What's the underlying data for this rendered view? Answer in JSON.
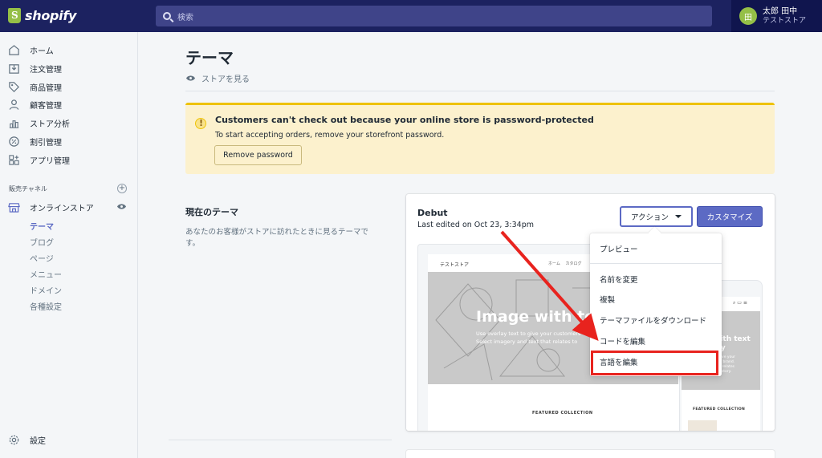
{
  "app": {
    "name": "shopify"
  },
  "search": {
    "placeholder": "検索"
  },
  "user": {
    "initial": "田",
    "name": "太郎 田中",
    "store": "テストストア"
  },
  "sidebar": {
    "items": [
      {
        "label": "ホーム",
        "icon": "home-icon"
      },
      {
        "label": "注文管理",
        "icon": "orders-icon"
      },
      {
        "label": "商品管理",
        "icon": "tag-icon"
      },
      {
        "label": "顧客管理",
        "icon": "person-icon"
      },
      {
        "label": "ストア分析",
        "icon": "analytics-icon"
      },
      {
        "label": "割引管理",
        "icon": "discount-icon"
      },
      {
        "label": "アプリ管理",
        "icon": "apps-icon"
      }
    ],
    "channels_label": "販売チャネル",
    "online_store": "オンラインストア",
    "sub_items": [
      "テーマ",
      "ブログ",
      "ページ",
      "メニュー",
      "ドメイン",
      "各種設定"
    ],
    "settings": "設定"
  },
  "page": {
    "title": "テーマ",
    "view_store": "ストアを見る"
  },
  "banner": {
    "title": "Customers can't check out because your online store is password-protected",
    "text": "To start accepting orders, remove your storefront password.",
    "button": "Remove password"
  },
  "current_theme": {
    "section_title": "現在のテーマ",
    "description": "あなたのお客様がストアに訪れたときに見るテーマです。",
    "name": "Debut",
    "edited": "Last edited on Oct 23, 3:34pm",
    "action_button": "アクション",
    "customize_button": "カスタマイズ"
  },
  "preview": {
    "store": "テストストア",
    "nav": "ホーム　 カタログ",
    "hero_title": "Image with text",
    "hero_sub_1": "Use overlay text to give your customers",
    "hero_sub_2": "Select imagery and text that relates to",
    "featured": "FEATURED COLLECTION",
    "mobile_hero_1": "with text",
    "mobile_hero_2": "lay",
    "mobile_sub": "to give your\nyour brand.\nthat relates\nand story.",
    "mobile_featured": "FEATURED COLLECTION"
  },
  "dropdown": {
    "items": [
      "プレビュー",
      "名前を変更",
      "複製",
      "テーマファイルをダウンロード",
      "コードを編集",
      "言語を編集"
    ]
  },
  "colors": {
    "topbar": "#1c2260",
    "accent": "#5c6ac4",
    "banner": "#fcf1cd",
    "highlight": "#e8231e"
  }
}
